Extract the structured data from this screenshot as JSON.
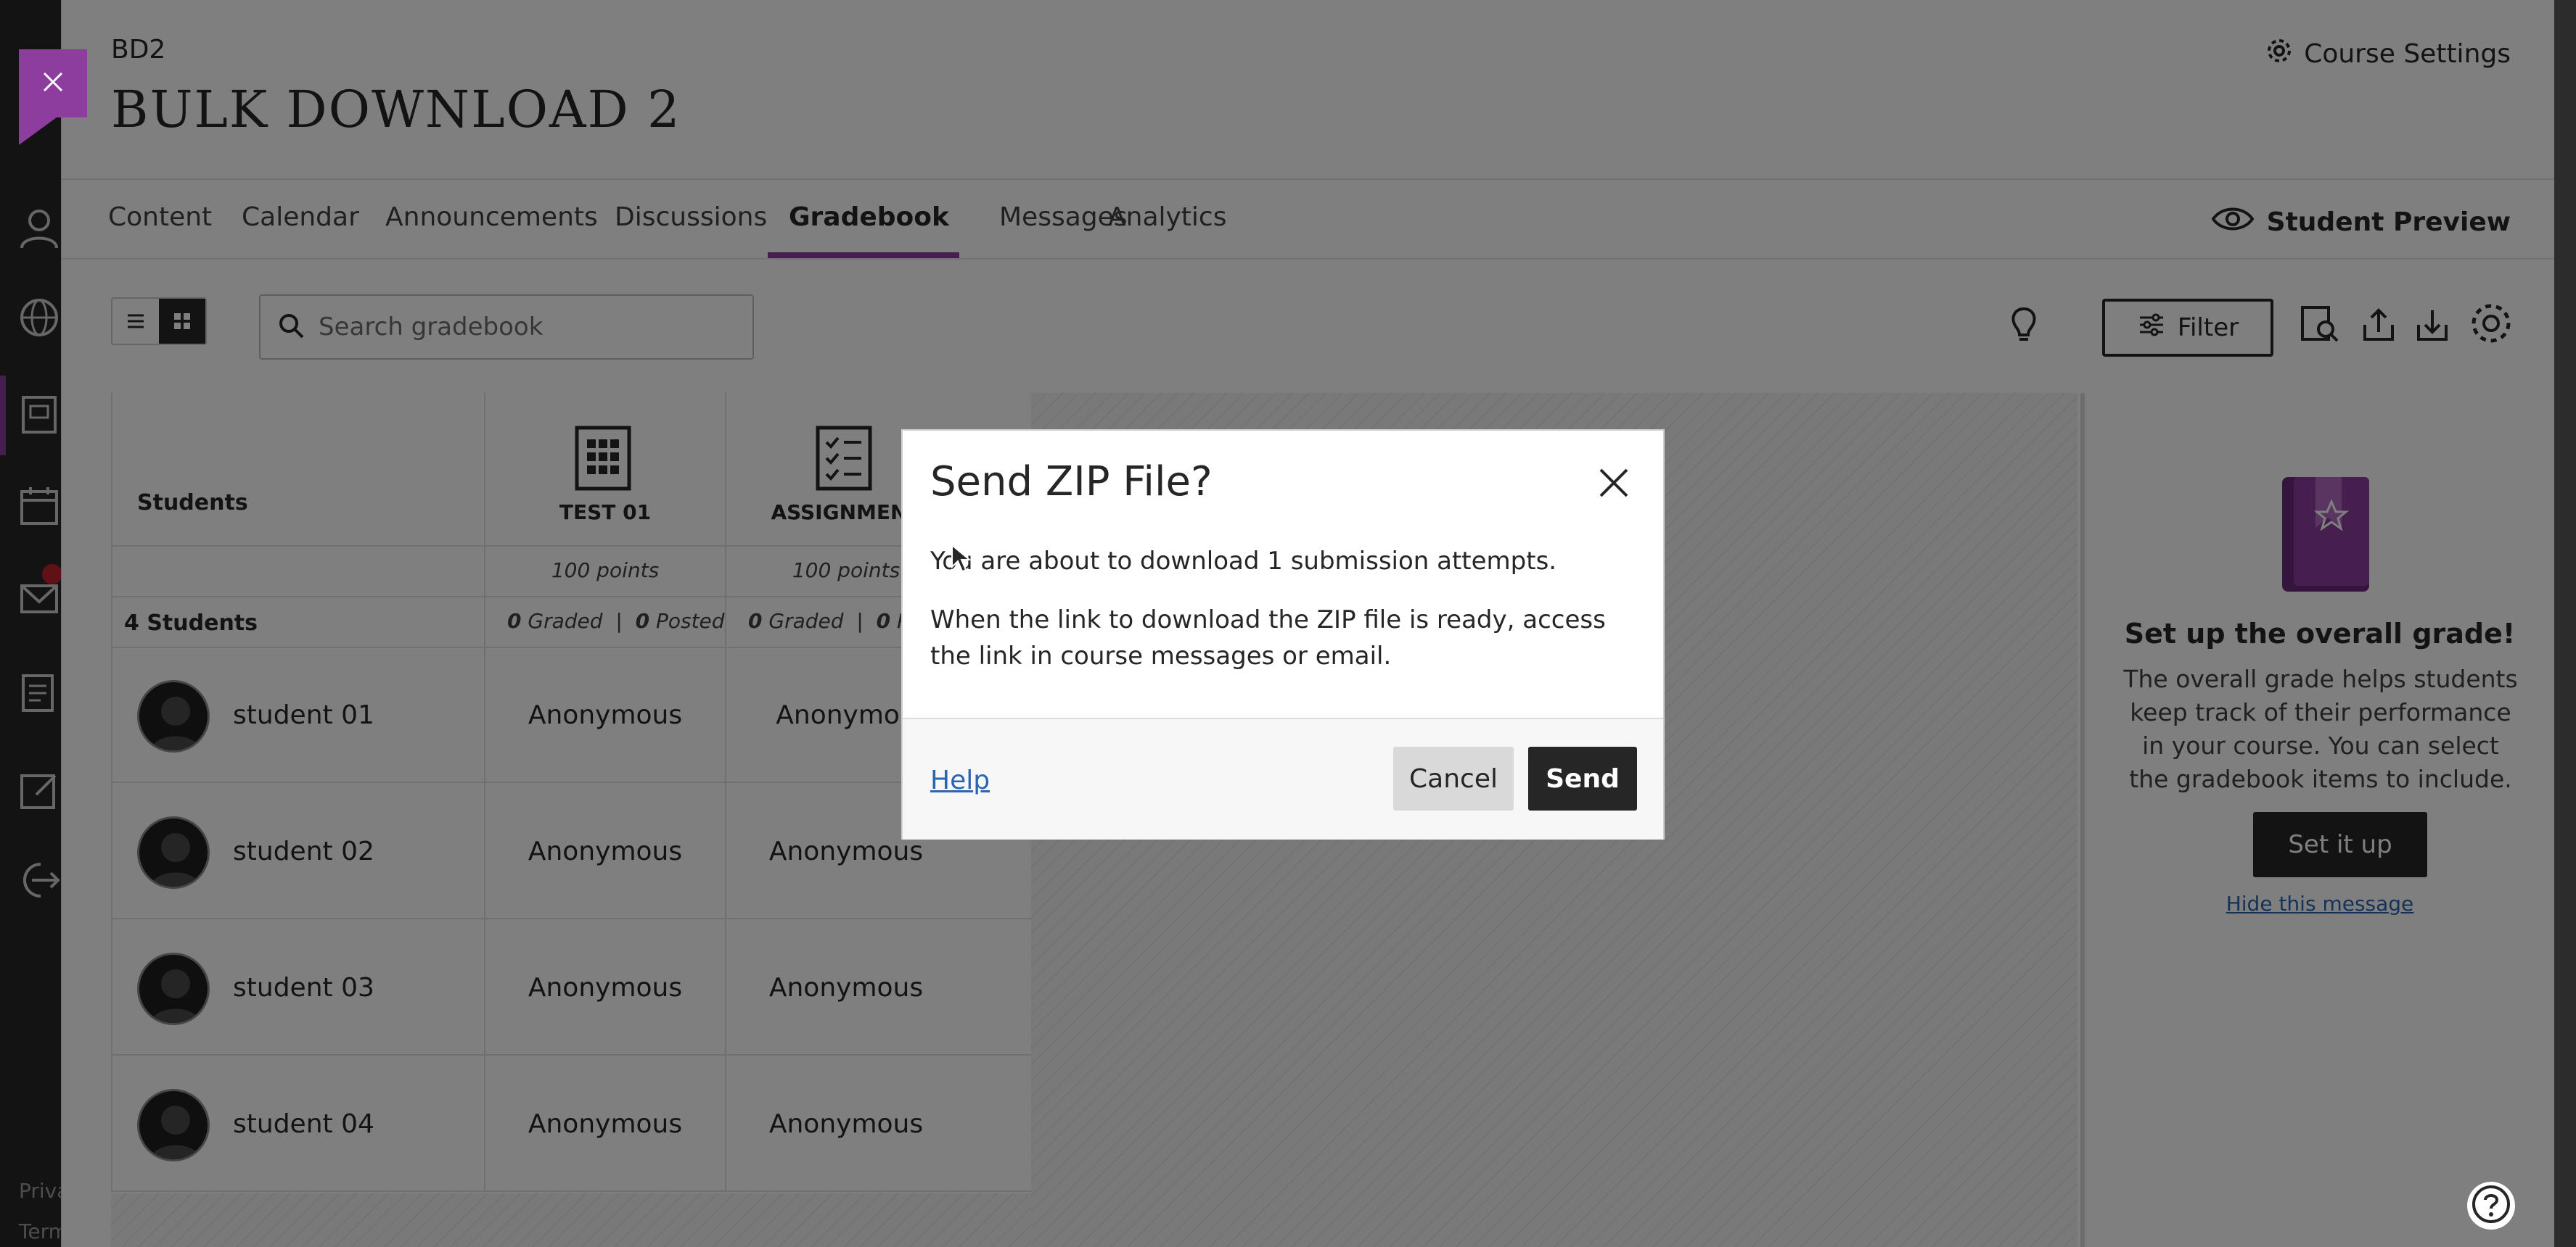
{
  "course": {
    "code": "BD2",
    "title": "BULK DOWNLOAD 2",
    "settings_label": "Course Settings",
    "student_preview_label": "Student Preview"
  },
  "tabs": [
    {
      "label": "Content"
    },
    {
      "label": "Calendar"
    },
    {
      "label": "Announcements"
    },
    {
      "label": "Discussions"
    },
    {
      "label": "Gradebook",
      "active": true
    },
    {
      "label": "Messages"
    },
    {
      "label": "Analytics"
    }
  ],
  "toolbar": {
    "search_placeholder": "Search gradebook",
    "filter_label": "Filter"
  },
  "leftnav_footer": [
    "Priva",
    "Term"
  ],
  "gradebook": {
    "students_header": "Students",
    "student_count": "4 Students",
    "columns": [
      {
        "title": "TEST 01",
        "points": "100 points",
        "graded": "0",
        "graded_label": "Graded",
        "posted": "0",
        "posted_label": "Posted"
      },
      {
        "title": "ASSIGNMENT",
        "points": "100 points",
        "graded": "0",
        "graded_label": "Graded",
        "posted": "0",
        "posted_label": "Po"
      }
    ],
    "rows": [
      {
        "name": "student 01",
        "cells": [
          "Anonymous",
          "Anonymou"
        ]
      },
      {
        "name": "student 02",
        "cells": [
          "Anonymous",
          "Anonymous"
        ]
      },
      {
        "name": "student 03",
        "cells": [
          "Anonymous",
          "Anonymous"
        ]
      },
      {
        "name": "student 04",
        "cells": [
          "Anonymous",
          "Anonymous"
        ]
      }
    ]
  },
  "overall_grade_panel": {
    "title": "Set up the overall grade!",
    "text": "The overall grade helps students keep track of their performance in your course. You can select the gradebook items to include.",
    "button_label": "Set it up",
    "hide_link": "Hide this message"
  },
  "dialog": {
    "title": "Send ZIP File?",
    "message1": "You are about to download 1 submission attempts.",
    "message2": "When the link to download the ZIP file is ready, access the link in course messages or email.",
    "help_link": "Help",
    "cancel_label": "Cancel",
    "send_label": "Send"
  },
  "colors": {
    "accent": "#8c3d9e",
    "dark": "#262626",
    "link": "#2a64b3"
  }
}
